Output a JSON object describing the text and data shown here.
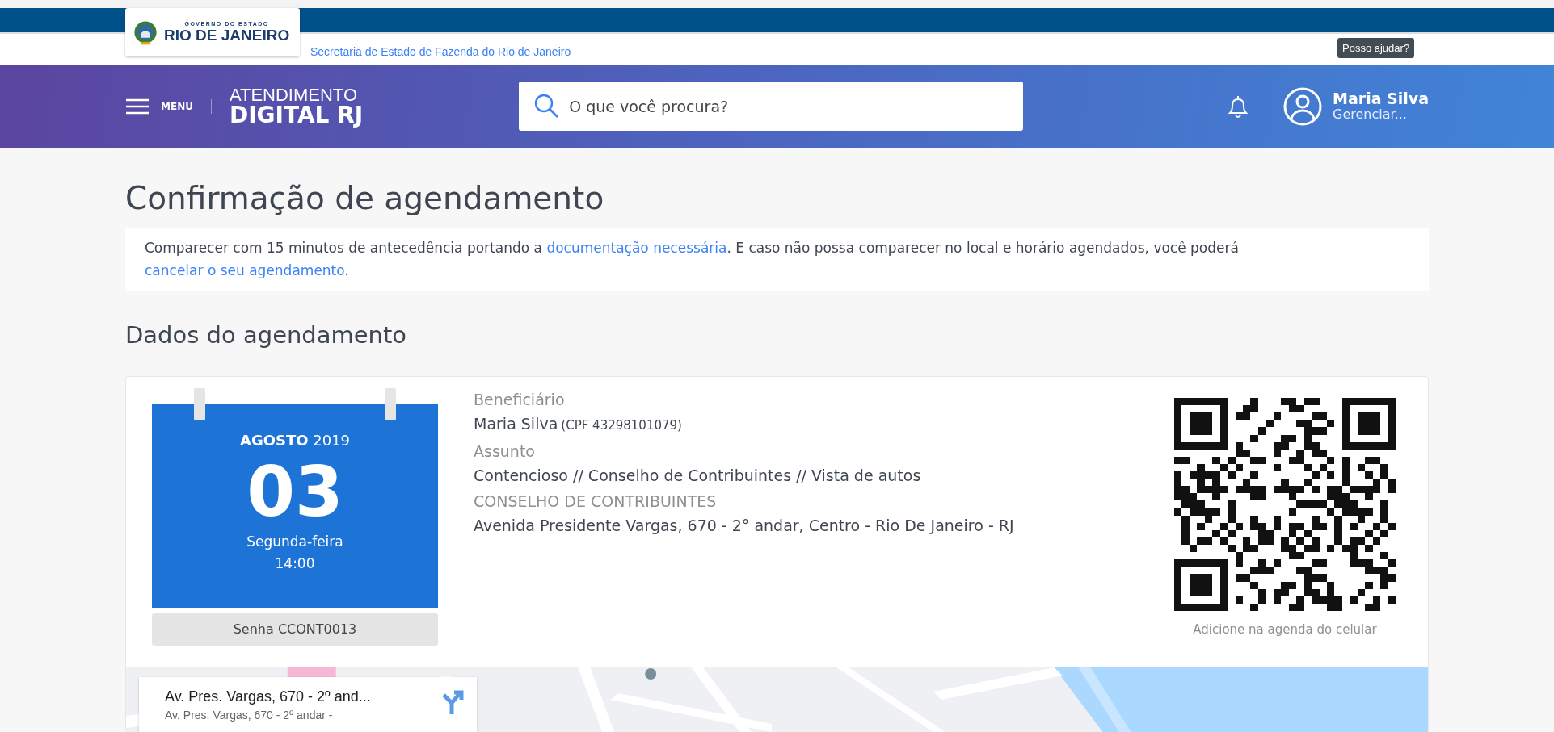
{
  "top_bar": {
    "logo": {
      "line_1": "GOVERNO DO ESTADO",
      "line_2": "RIO DE JANEIRO"
    },
    "agency_link": "Secretaria de Estado de Fazenda do Rio de Janeiro",
    "help_tooltip": "Posso ajudar?"
  },
  "header": {
    "menu_label": "MENU",
    "brand_line_1": "ATENDIMENTO",
    "brand_line_2": "DIGITAL RJ",
    "search": {
      "placeholder": "O que você procura?"
    },
    "user": {
      "name": "Maria Silva",
      "action": "Gerenciar..."
    }
  },
  "page": {
    "title": "Confirmação de agendamento",
    "notice": [
      {
        "kind": "text",
        "text": "Comparecer com 15 minutos de antecedência portando a"
      },
      {
        "kind": "link",
        "text": "documentação necessária"
      },
      {
        "kind": "text",
        "text": ". E caso não possa comparecer no local e horário agendados, você poderá"
      },
      {
        "kind": "link",
        "text": "cancelar o seu agendamento"
      },
      {
        "kind": "text",
        "text": "."
      }
    ],
    "section_title": "Dados do agendamento"
  },
  "appointment": {
    "month": "AGOSTO",
    "year": "2019",
    "day": "03",
    "weekday": "Segunda-feira",
    "time": "14:00",
    "ticket": "Senha CCONT0013",
    "fields": [
      {
        "label": "Beneficiário",
        "value": "Maria Silva",
        "note": "(CPF 43298101079)"
      },
      {
        "label": "Assunto",
        "value": "Contencioso // Conselho de Contribuintes // Vista de autos"
      },
      {
        "label": "CONSELHO DE CONTRIBUINTES",
        "value": "Avenida Presidente Vargas, 670 - 2° andar, Centro - Rio De Janeiro - RJ"
      }
    ],
    "qr_caption": "Adicione na agenda do celular"
  },
  "map": {
    "kind": "picture",
    "place_card": {
      "title": "Av. Pres. Vargas, 670 - 2º and...",
      "subtitle": "Av. Pres. Vargas, 670 - 2º andar -"
    }
  }
}
